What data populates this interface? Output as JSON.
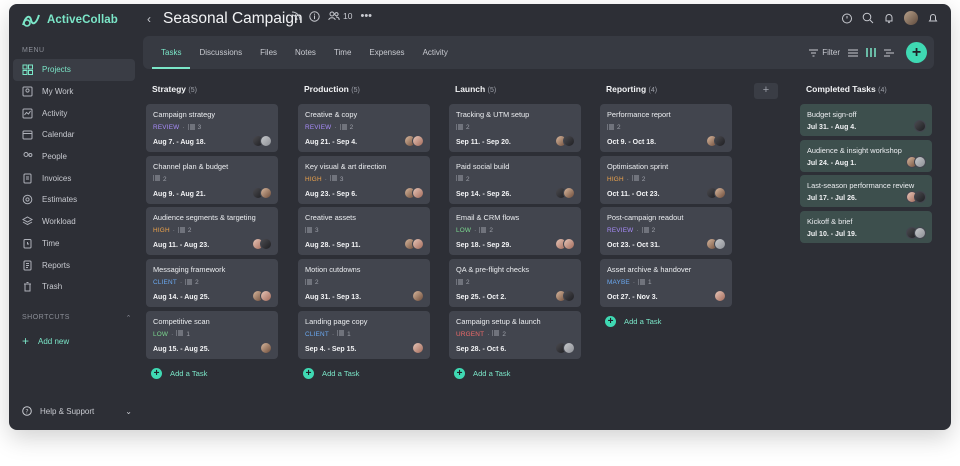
{
  "app": {
    "name": "ActiveCollab"
  },
  "sidebar": {
    "menu_caption": "MENU",
    "items": [
      {
        "label": "Projects",
        "icon": "projects-icon",
        "active": true
      },
      {
        "label": "My Work",
        "icon": "my-work-icon"
      },
      {
        "label": "Activity",
        "icon": "activity-icon"
      },
      {
        "label": "Calendar",
        "icon": "calendar-icon"
      },
      {
        "label": "People",
        "icon": "people-icon"
      },
      {
        "label": "Invoices",
        "icon": "invoices-icon"
      },
      {
        "label": "Estimates",
        "icon": "estimates-icon"
      },
      {
        "label": "Workload",
        "icon": "workload-icon"
      },
      {
        "label": "Time",
        "icon": "time-icon"
      },
      {
        "label": "Reports",
        "icon": "reports-icon"
      },
      {
        "label": "Trash",
        "icon": "trash-icon"
      }
    ],
    "shortcuts_caption": "SHORTCUTS",
    "add_new": "Add new",
    "help": "Help & Support"
  },
  "header": {
    "project_title": "Seasonal Campaign",
    "member_count": "10"
  },
  "tabs": [
    "Tasks",
    "Discussions",
    "Files",
    "Notes",
    "Time",
    "Expenses",
    "Activity"
  ],
  "active_tab": "Tasks",
  "toolbar": {
    "filter_label": "Filter"
  },
  "add_task_label": "Add a Task",
  "label_colors": {
    "REVIEW": "#a78bfa",
    "HIGH": "#f0a44b",
    "CLIENT": "#6aa8f0",
    "LOW": "#7bd88f",
    "URGENT": "#f06a6a",
    "MAYBE": "#6aa8f0"
  },
  "columns": [
    {
      "name": "Strategy",
      "count": "(5)",
      "tasks": [
        {
          "title": "Campaign strategy",
          "label": "REVIEW",
          "subtasks": "3",
          "dates": "Aug 7. - Aug 18.",
          "avatars": [
            "av2",
            "av4"
          ]
        },
        {
          "title": "Channel plan & budget",
          "label": "",
          "subtasks": "2",
          "dates": "Aug 9. - Aug 21.",
          "avatars": [
            "av2",
            "av1"
          ]
        },
        {
          "title": "Audience segments & targeting",
          "label": "HIGH",
          "subtasks": "2",
          "dates": "Aug 11. - Aug 23.",
          "avatars": [
            "av3",
            "av2"
          ]
        },
        {
          "title": "Messaging framework",
          "label": "CLIENT",
          "subtasks": "2",
          "dates": "Aug 14. - Aug 25.",
          "avatars": [
            "av1",
            "av3"
          ]
        },
        {
          "title": "Competitive scan",
          "label": "LOW",
          "subtasks": "1",
          "dates": "Aug 15. - Aug 25.",
          "avatars": [
            "av1"
          ]
        }
      ]
    },
    {
      "name": "Production",
      "count": "(5)",
      "tasks": [
        {
          "title": "Creative & copy",
          "label": "REVIEW",
          "subtasks": "2",
          "dates": "Aug 21. - Sep 4.",
          "avatars": [
            "av1",
            "av3"
          ]
        },
        {
          "title": "Key visual & art direction",
          "label": "HIGH",
          "subtasks": "3",
          "dates": "Aug 23. - Sep 6.",
          "avatars": [
            "av1",
            "av3"
          ]
        },
        {
          "title": "Creative assets",
          "label": "",
          "subtasks": "3",
          "dates": "Aug 28. - Sep 11.",
          "avatars": [
            "av1",
            "av3"
          ]
        },
        {
          "title": "Motion cutdowns",
          "label": "",
          "subtasks": "2",
          "dates": "Aug 31. - Sep 13.",
          "avatars": [
            "av1"
          ]
        },
        {
          "title": "Landing page copy",
          "label": "CLIENT",
          "subtasks": "1",
          "dates": "Sep 4. - Sep 15.",
          "avatars": [
            "av3"
          ]
        }
      ]
    },
    {
      "name": "Launch",
      "count": "(5)",
      "tasks": [
        {
          "title": "Tracking & UTM setup",
          "label": "",
          "subtasks": "2",
          "dates": "Sep 11. - Sep 20.",
          "avatars": [
            "av1",
            "av2"
          ]
        },
        {
          "title": "Paid social build",
          "label": "",
          "subtasks": "2",
          "dates": "Sep 14. - Sep 26.",
          "avatars": [
            "av2",
            "av1"
          ]
        },
        {
          "title": "Email & CRM flows",
          "label": "LOW",
          "subtasks": "2",
          "dates": "Sep 18. - Sep 29.",
          "avatars": [
            "av3",
            "av3"
          ]
        },
        {
          "title": "QA & pre-flight checks",
          "label": "",
          "subtasks": "2",
          "dates": "Sep 25. - Oct 2.",
          "avatars": [
            "av1",
            "av2"
          ]
        },
        {
          "title": "Campaign setup & launch",
          "label": "URGENT",
          "subtasks": "2",
          "dates": "Sep 28. - Oct 6.",
          "avatars": [
            "av2",
            "av4"
          ]
        }
      ]
    },
    {
      "name": "Reporting",
      "count": "(4)",
      "tasks": [
        {
          "title": "Performance report",
          "label": "",
          "subtasks": "2",
          "dates": "Oct 9. - Oct 18.",
          "avatars": [
            "av1",
            "av2"
          ]
        },
        {
          "title": "Optimisation sprint",
          "label": "HIGH",
          "subtasks": "2",
          "dates": "Oct 11. - Oct 23.",
          "avatars": [
            "av2",
            "av1"
          ]
        },
        {
          "title": "Post-campaign readout",
          "label": "REVIEW",
          "subtasks": "2",
          "dates": "Oct 23. - Oct 31.",
          "avatars": [
            "av1",
            "av4"
          ]
        },
        {
          "title": "Asset archive & handover",
          "label": "MAYBE",
          "subtasks": "1",
          "dates": "Oct 27. - Nov 3.",
          "avatars": [
            "av3"
          ]
        }
      ]
    },
    {
      "name": "Completed Tasks",
      "count": "(4)",
      "done": true,
      "tasks": [
        {
          "title": "Budget sign-off",
          "dates": "Jul 31. - Aug 4.",
          "avatars": [
            "av2"
          ]
        },
        {
          "title": "Audience & insight workshop",
          "dates": "Jul 24. - Aug 1.",
          "avatars": [
            "av1",
            "av4"
          ]
        },
        {
          "title": "Last-season performance review",
          "dates": "Jul 17. - Jul 26.",
          "avatars": [
            "av3",
            "av2"
          ]
        },
        {
          "title": "Kickoff & brief",
          "dates": "Jul 10. - Jul 19.",
          "avatars": [
            "av2",
            "av4"
          ]
        }
      ]
    }
  ]
}
